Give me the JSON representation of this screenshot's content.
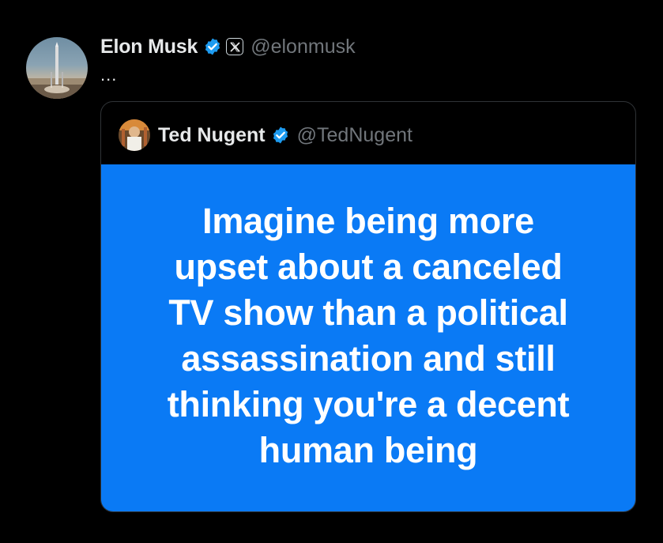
{
  "tweet": {
    "author_name": "Elon Musk",
    "author_handle": "@elonmusk",
    "more_label": "...",
    "affiliation_badge": "x-logo-icon",
    "verified_color": "#1d9bf0"
  },
  "quote": {
    "author_name": "Ted Nugent",
    "author_handle": "@TedNugent",
    "image_background": "#0a7af5",
    "image_lines": [
      "Imagine being more",
      "upset about a canceled",
      "TV show than a political",
      "assassination and still",
      "thinking you're a decent",
      "human being"
    ]
  },
  "colors": {
    "background": "#000000",
    "primary_text": "#e7e9ea",
    "secondary_text": "#71767b",
    "border": "#2f3336"
  }
}
